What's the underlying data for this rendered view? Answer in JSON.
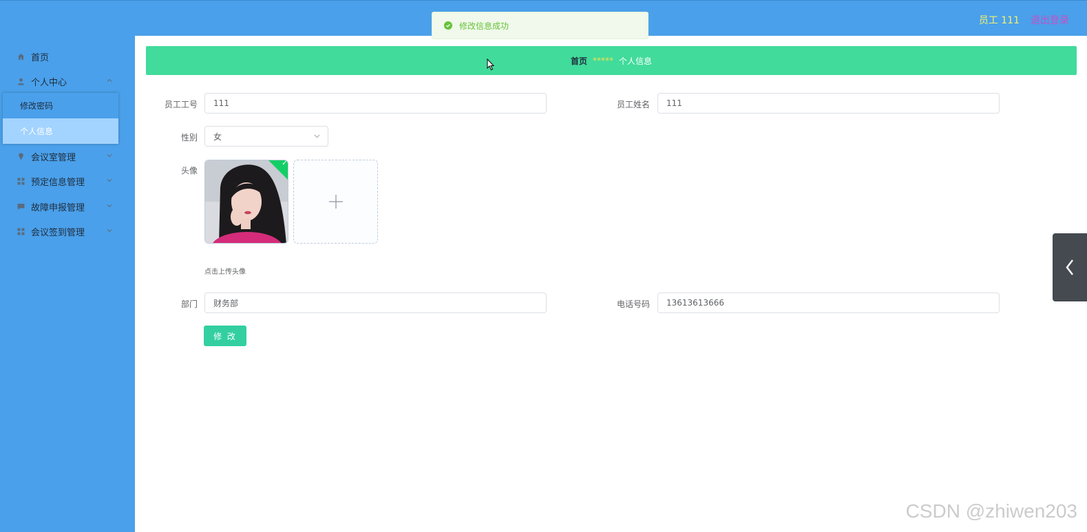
{
  "header": {
    "user_label": "员工 111",
    "logout_label": "退出登录",
    "colors": {
      "bar": "#4aa0ea",
      "user": "#f7f36a",
      "logout": "#c74fc7"
    }
  },
  "toast": {
    "message": "修改信息成功",
    "icon": "success-check-icon"
  },
  "sidebar": {
    "items": [
      {
        "label": "首页",
        "icon": "home-icon"
      },
      {
        "label": "个人中心",
        "icon": "user-icon"
      },
      {
        "label": "会议室管理",
        "icon": "pin-icon"
      },
      {
        "label": "预定信息管理",
        "icon": "grid-icon"
      },
      {
        "label": "故障申报管理",
        "icon": "chat-icon"
      },
      {
        "label": "会议签到管理",
        "icon": "grid-icon"
      }
    ],
    "personal_submenu": [
      {
        "label": "修改密码"
      },
      {
        "label": "个人信息",
        "active": true
      }
    ]
  },
  "breadcrumb": {
    "home": "首页",
    "separator": "*****",
    "current": "个人信息"
  },
  "form": {
    "employee_no": {
      "label": "员工工号",
      "value": "111"
    },
    "employee_name": {
      "label": "员工姓名",
      "value": "111"
    },
    "gender": {
      "label": "性别",
      "value": "女"
    },
    "avatar": {
      "label": "头像",
      "tip": "点击上传头像"
    },
    "department": {
      "label": "部门",
      "value": "财务部"
    },
    "phone": {
      "label": "电话号码",
      "value": "13613613666"
    },
    "submit_label": "修 改"
  },
  "watermark": "CSDN @zhiwen203"
}
